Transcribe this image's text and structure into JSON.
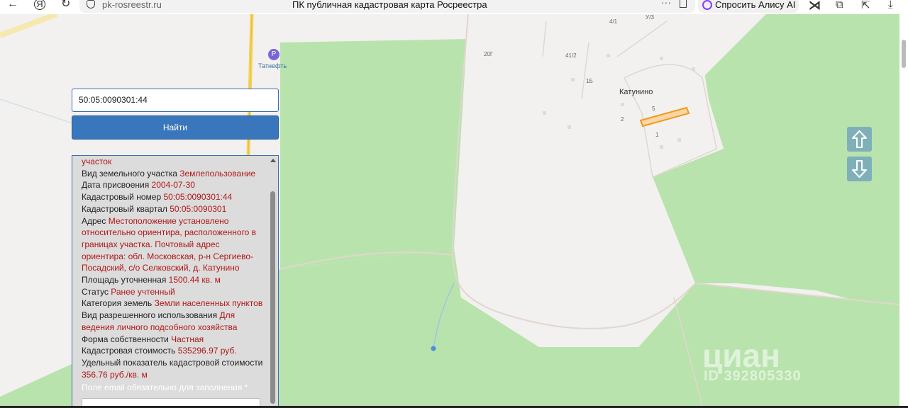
{
  "browser": {
    "url": "pk-rosreestr.ru",
    "page_title": "ПК публичная кадастровая карта Росреестра",
    "alice_label": "Спросить Алису AI",
    "more_dots": "···"
  },
  "map": {
    "poi": "Татнефть",
    "settlement": "Катунино",
    "labels": [
      "4/1",
      "20Г",
      "41/2",
      "1Б",
      "5",
      "2",
      "1",
      "У/З"
    ]
  },
  "search": {
    "value": "50:05:0090301:44",
    "button_label": "Найти"
  },
  "info": {
    "cut_value": "участок",
    "rows": [
      {
        "label": "Вид земельного участка",
        "value": "Землепользование"
      },
      {
        "label": "Дата присвоения",
        "value": "2004-07-30"
      },
      {
        "label": "Кадастровый номер",
        "value": "50:05:0090301:44"
      },
      {
        "label": "Кадастровый квартал",
        "value": "50:05:0090301"
      },
      {
        "label": "Адрес",
        "value": "Местоположение установлено относительно ориентира, расположенного в границах участка. Почтовый адрес ориентира: обл. Московская, р-н Сергиево-Посадский, с/о Селковский, д. Катунино"
      },
      {
        "label": "Площадь уточненная",
        "value": "1500.44 кв. м"
      },
      {
        "label": "Статус",
        "value": "Ранее учтенный"
      },
      {
        "label": "Категория земель",
        "value": "Земли населенных пунктов"
      },
      {
        "label": "Вид разрешенного использования",
        "value": "Для ведения личного подсобного хозяйства"
      },
      {
        "label": "Форма собственности",
        "value": "Частная"
      },
      {
        "label": "Кадастровая стоимость",
        "value": "535296.97 руб."
      },
      {
        "label": "Удельный показатель кадастровой стоимости",
        "value": "356.76 руб./кв. м"
      }
    ],
    "email_required": "Поле email обязательно для заполнения *"
  },
  "watermark": {
    "brand": "циан",
    "id": "ID 392805330"
  },
  "colors": {
    "forest": "#b9e3ad",
    "field": "#f2f1ef",
    "parcel": "#f39a1f",
    "button": "#3a76bb",
    "value_text": "#b01818"
  }
}
